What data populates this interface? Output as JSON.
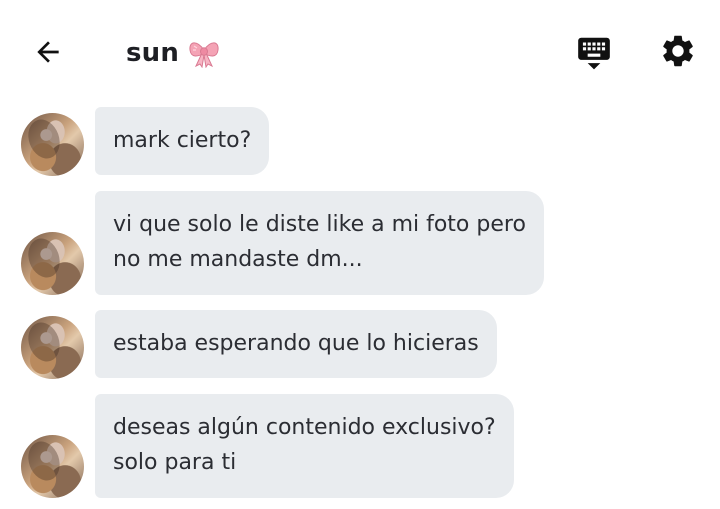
{
  "header": {
    "back_icon": "arrow-left-icon",
    "title": "sun",
    "title_emoji_icon": "pink-bow-icon",
    "keyboard_icon": "keyboard-icon",
    "settings_icon": "gear-icon"
  },
  "messages": [
    {
      "lines": [
        "mark cierto?"
      ]
    },
    {
      "lines": [
        "vi que solo le diste like a mi foto pero",
        "no me mandaste dm..."
      ]
    },
    {
      "lines": [
        "estaba esperando que lo hicieras"
      ]
    },
    {
      "lines": [
        "deseas algún contenido exclusivo?",
        "solo para ti"
      ]
    }
  ],
  "colors": {
    "bubble_bg": "#e9ecef",
    "text": "#2b2d33",
    "icon": "#111111",
    "bow": "#f4a3b5"
  }
}
